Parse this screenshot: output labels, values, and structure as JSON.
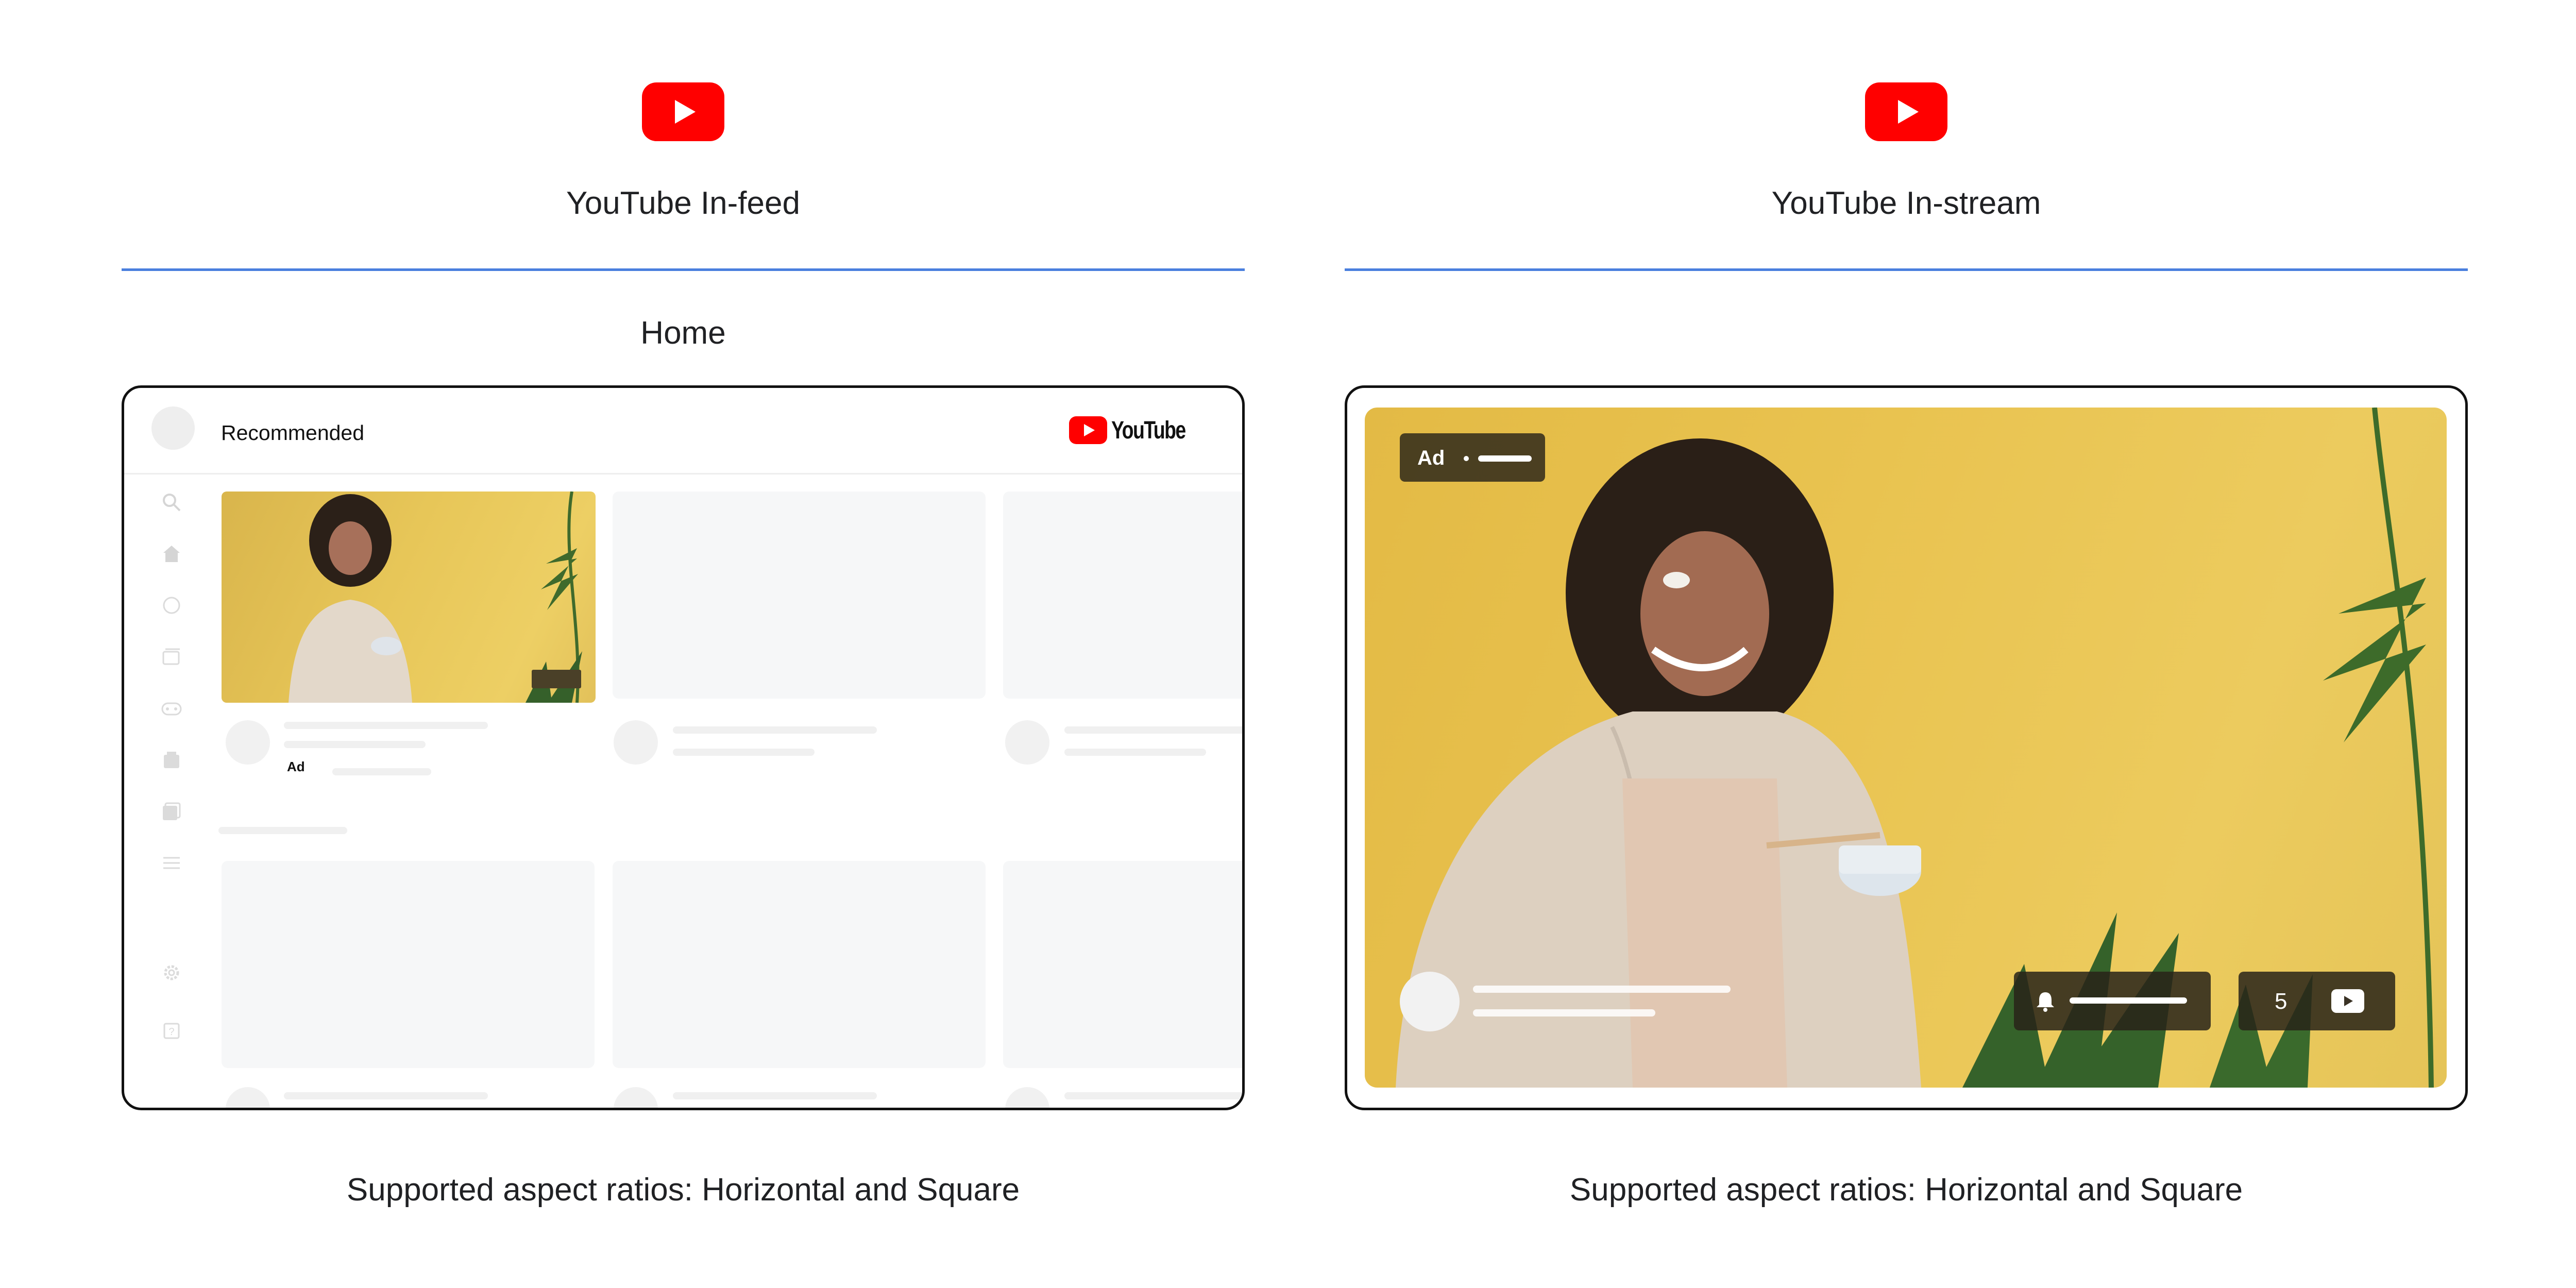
{
  "colors": {
    "youtube_red": "#ff0000",
    "divider_blue": "#4a7fde",
    "frame_border": "#111111",
    "placeholder_gray": "#f6f7f8",
    "video_background": "#e9c350"
  },
  "panels": [
    {
      "icon": "youtube-play-icon",
      "title": "YouTube In-feed",
      "surface_label": "Home",
      "caption": "Supported aspect ratios: Horizontal and Square",
      "mock": {
        "section_title": "Recommended",
        "logo_text": "YouTube",
        "ad_label": "Ad",
        "sidebar_icons": [
          "search-icon",
          "home-icon",
          "explore-icon",
          "subscriptions-icon",
          "games-icon",
          "library-icon",
          "history-icon",
          "menu-icon",
          "settings-icon",
          "help-icon"
        ]
      }
    },
    {
      "icon": "youtube-play-icon",
      "title": "YouTube In-stream",
      "caption": "Supported aspect ratios: Horizontal and Square",
      "mock": {
        "ad_label": "Ad",
        "skip_count": "5",
        "icons": [
          "bell-icon",
          "youtube-small-icon"
        ]
      }
    }
  ]
}
